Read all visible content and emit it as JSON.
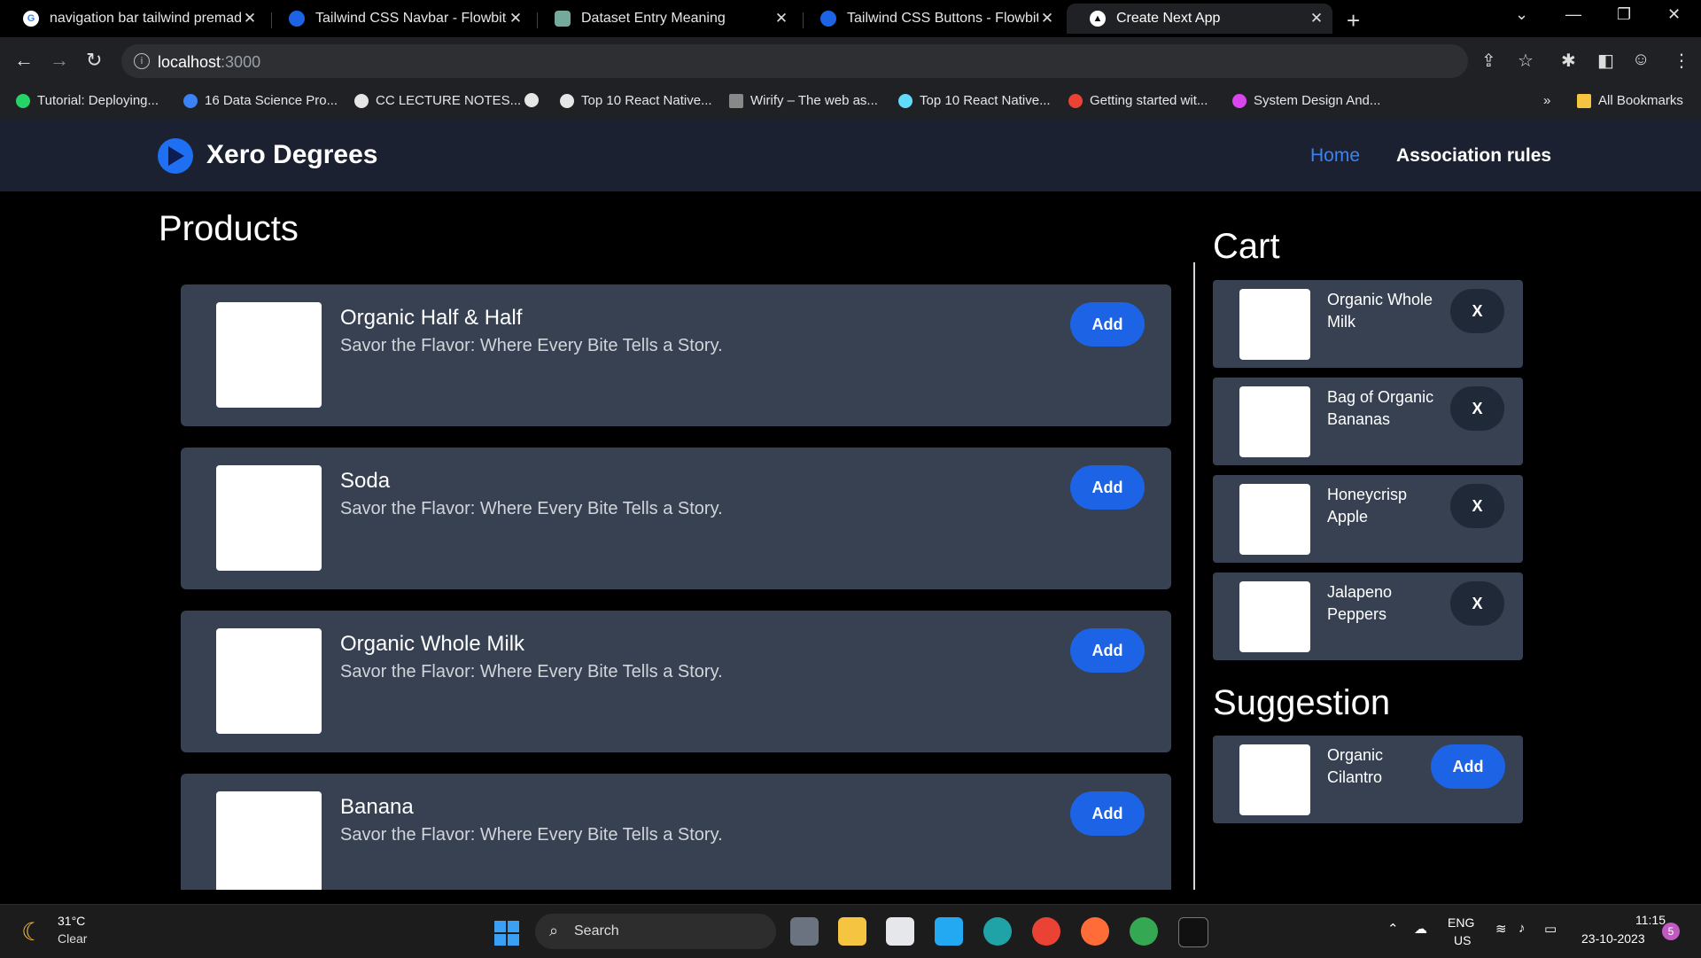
{
  "browser": {
    "tabs": [
      {
        "title": "navigation bar tailwind premade",
        "icon": "google-icon",
        "active": false
      },
      {
        "title": "Tailwind CSS Navbar - Flowbite",
        "icon": "flowbite-icon",
        "active": false
      },
      {
        "title": "Dataset Entry Meaning",
        "icon": "chatgpt-icon",
        "active": false
      },
      {
        "title": "Tailwind CSS Buttons - Flowbite",
        "icon": "flowbite-icon",
        "active": false
      },
      {
        "title": "Create Next App",
        "icon": "nextjs-icon",
        "active": true
      }
    ],
    "address": {
      "host": "localhost",
      "port": ":3000"
    },
    "bookmarks": [
      {
        "label": "Tutorial: Deploying...",
        "icon": "whatsapp-icon",
        "color": "#25d366"
      },
      {
        "label": "16 Data Science Pro...",
        "icon": "site-icon",
        "color": "#3b82f6"
      },
      {
        "label": "CC LECTURE NOTES...",
        "icon": "globe-icon",
        "color": "#e6e6e6"
      },
      {
        "label": "",
        "icon": "globe-icon",
        "color": "#e6e6e6"
      },
      {
        "label": "Top 10 React Native...",
        "icon": "globe-icon",
        "color": "#e6e6e6"
      },
      {
        "label": "Wirify – The web as...",
        "icon": "wirify-icon",
        "color": "#888888"
      },
      {
        "label": "Top 10 React Native...",
        "icon": "react-icon",
        "color": "#61dafb"
      },
      {
        "label": "Getting started wit...",
        "icon": "google-icon",
        "color": "#ea4335"
      },
      {
        "label": "System Design And...",
        "icon": "star-icon",
        "color": "#d946ef"
      }
    ],
    "bookmarks_overflow": "»",
    "all_bookmarks": "All Bookmarks"
  },
  "site": {
    "brand": "Xero Degrees",
    "nav": {
      "home": "Home",
      "association_rules": "Association rules"
    },
    "products_title": "Products",
    "products": [
      {
        "name": "Organic Half & Half",
        "desc": "Savor the Flavor: Where Every Bite Tells a Story.",
        "button": "Add"
      },
      {
        "name": "Soda",
        "desc": "Savor the Flavor: Where Every Bite Tells a Story.",
        "button": "Add"
      },
      {
        "name": "Organic Whole Milk",
        "desc": "Savor the Flavor: Where Every Bite Tells a Story.",
        "button": "Add"
      },
      {
        "name": "Banana",
        "desc": "Savor the Flavor: Where Every Bite Tells a Story.",
        "button": "Add"
      }
    ],
    "cart_title": "Cart",
    "cart": [
      {
        "name": "Organic Whole Milk",
        "button": "X"
      },
      {
        "name": "Bag of Organic Bananas",
        "button": "X"
      },
      {
        "name": "Honeycrisp Apple",
        "button": "X"
      },
      {
        "name": "Jalapeno Peppers",
        "button": "X"
      }
    ],
    "suggestion_title": "Suggestion",
    "suggestions": [
      {
        "name": "Organic Cilantro",
        "button": "Add"
      }
    ],
    "colors": {
      "navbar": "#1b2130",
      "card": "#374151",
      "primary": "#1d63e6",
      "link_active": "#3b82f6"
    }
  },
  "taskbar": {
    "weather_temp": "31°C",
    "weather_desc": "Clear",
    "search": "Search",
    "lang": "ENG",
    "region": "US",
    "time": "11:15",
    "date": "23-10-2023",
    "notifications": "5"
  }
}
